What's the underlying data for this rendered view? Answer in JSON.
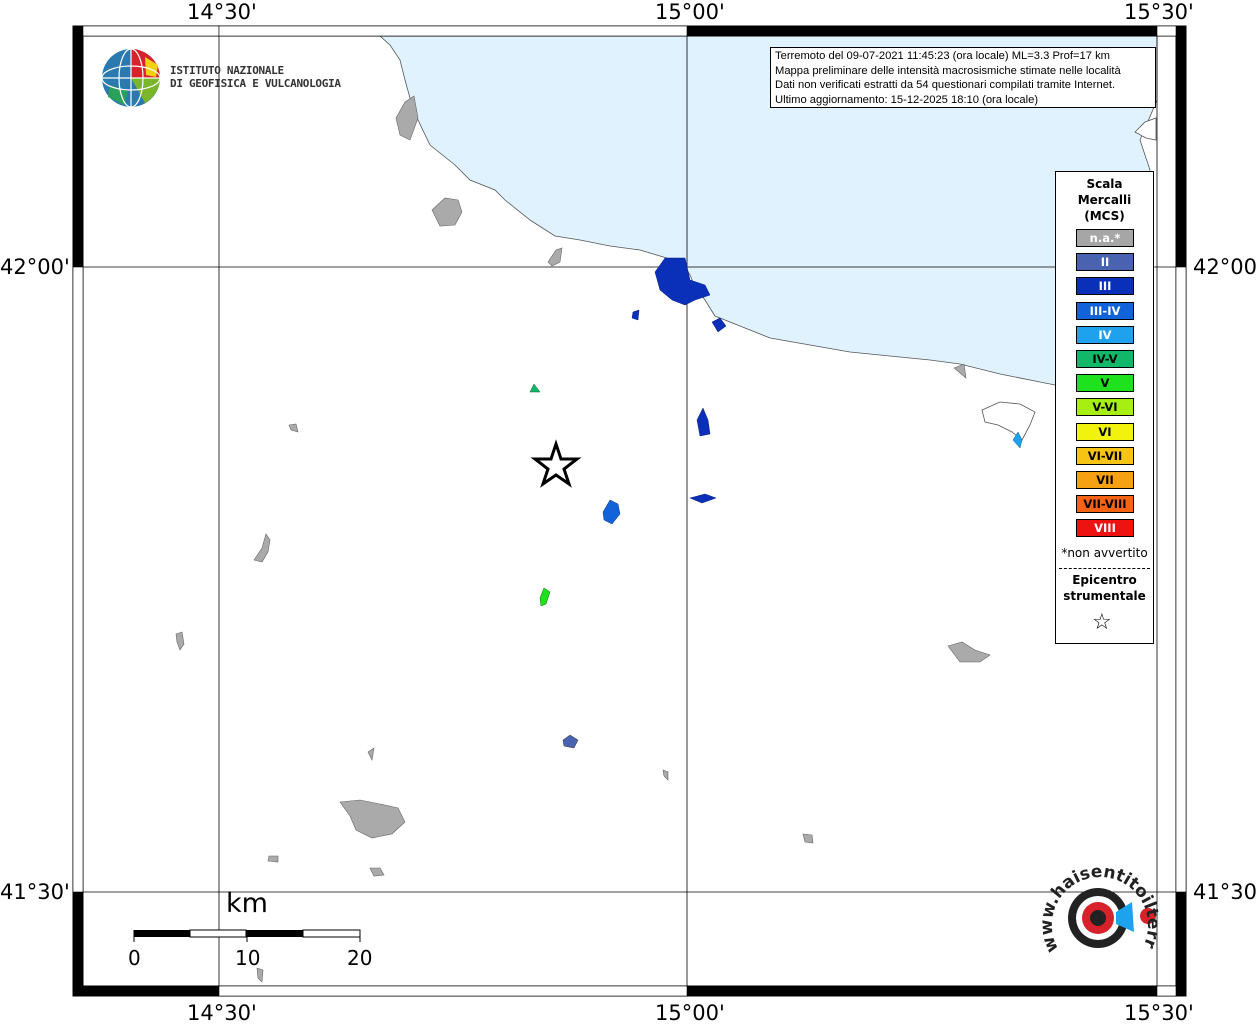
{
  "map": {
    "lon_labels": [
      "14°30'",
      "15°00'",
      "15°30'"
    ],
    "lat_labels": [
      "42°00'",
      "41°30'"
    ],
    "sea_color": "#dff2fd",
    "land_color": "#ffffff",
    "no_felt_color": "#aaaaaa",
    "epicenter_marker": "star"
  },
  "institute": {
    "name_line1": "ISTITUTO NAZIONALE",
    "name_line2": "DI GEOFISICA E VULCANOLOGIA",
    "logo_icon": "ingv-globe-logo"
  },
  "info": {
    "line1": "Terremoto del 09-07-2021 11:45:23 (ora locale) ML=3.3 Prof=17 km",
    "line2": "Mappa preliminare delle intensità macrosismiche stimate nelle località",
    "line3": "Dati non verificati estratti da 54 questionari compilati tramite Internet.",
    "line4": "Ultimo aggiornamento: 15-12-2025 18:10 (ora locale)"
  },
  "legend": {
    "title_line1": "Scala",
    "title_line2": "Mercalli",
    "title_line3": "(MCS)",
    "items": [
      {
        "label": "n.a.*",
        "color": "#a6a6a6",
        "text_color": "#ffffff"
      },
      {
        "label": "II",
        "color": "#4a63b0",
        "text_color": "#ffffff"
      },
      {
        "label": "III",
        "color": "#0a2fb8",
        "text_color": "#ffffff"
      },
      {
        "label": "III-IV",
        "color": "#1262d9",
        "text_color": "#ffffff"
      },
      {
        "label": "IV",
        "color": "#1ea2ee",
        "text_color": "#ffffff"
      },
      {
        "label": "IV-V",
        "color": "#12b86a",
        "text_color": "#000000"
      },
      {
        "label": "V",
        "color": "#1de21d",
        "text_color": "#000000"
      },
      {
        "label": "V-VI",
        "color": "#a7ef13",
        "text_color": "#000000"
      },
      {
        "label": "VI",
        "color": "#f2f20f",
        "text_color": "#000000"
      },
      {
        "label": "VI-VII",
        "color": "#f6c412",
        "text_color": "#000000"
      },
      {
        "label": "VII",
        "color": "#f6a112",
        "text_color": "#000000"
      },
      {
        "label": "VII-VIII",
        "color": "#f66312",
        "text_color": "#000000"
      },
      {
        "label": "VIII",
        "color": "#ee1212",
        "text_color": "#ffffff"
      }
    ],
    "note": "*non avvertito",
    "epicenter_line1": "Epicentro",
    "epicenter_line2": "strumentale",
    "epicenter_icon": "star-outline-icon"
  },
  "scale_bar": {
    "title": "km",
    "labels": [
      "0",
      "10",
      "20"
    ]
  },
  "haisentito": {
    "text": "www.haisentitoilterremoto.it",
    "logo_icon": "haisentito-logo"
  }
}
